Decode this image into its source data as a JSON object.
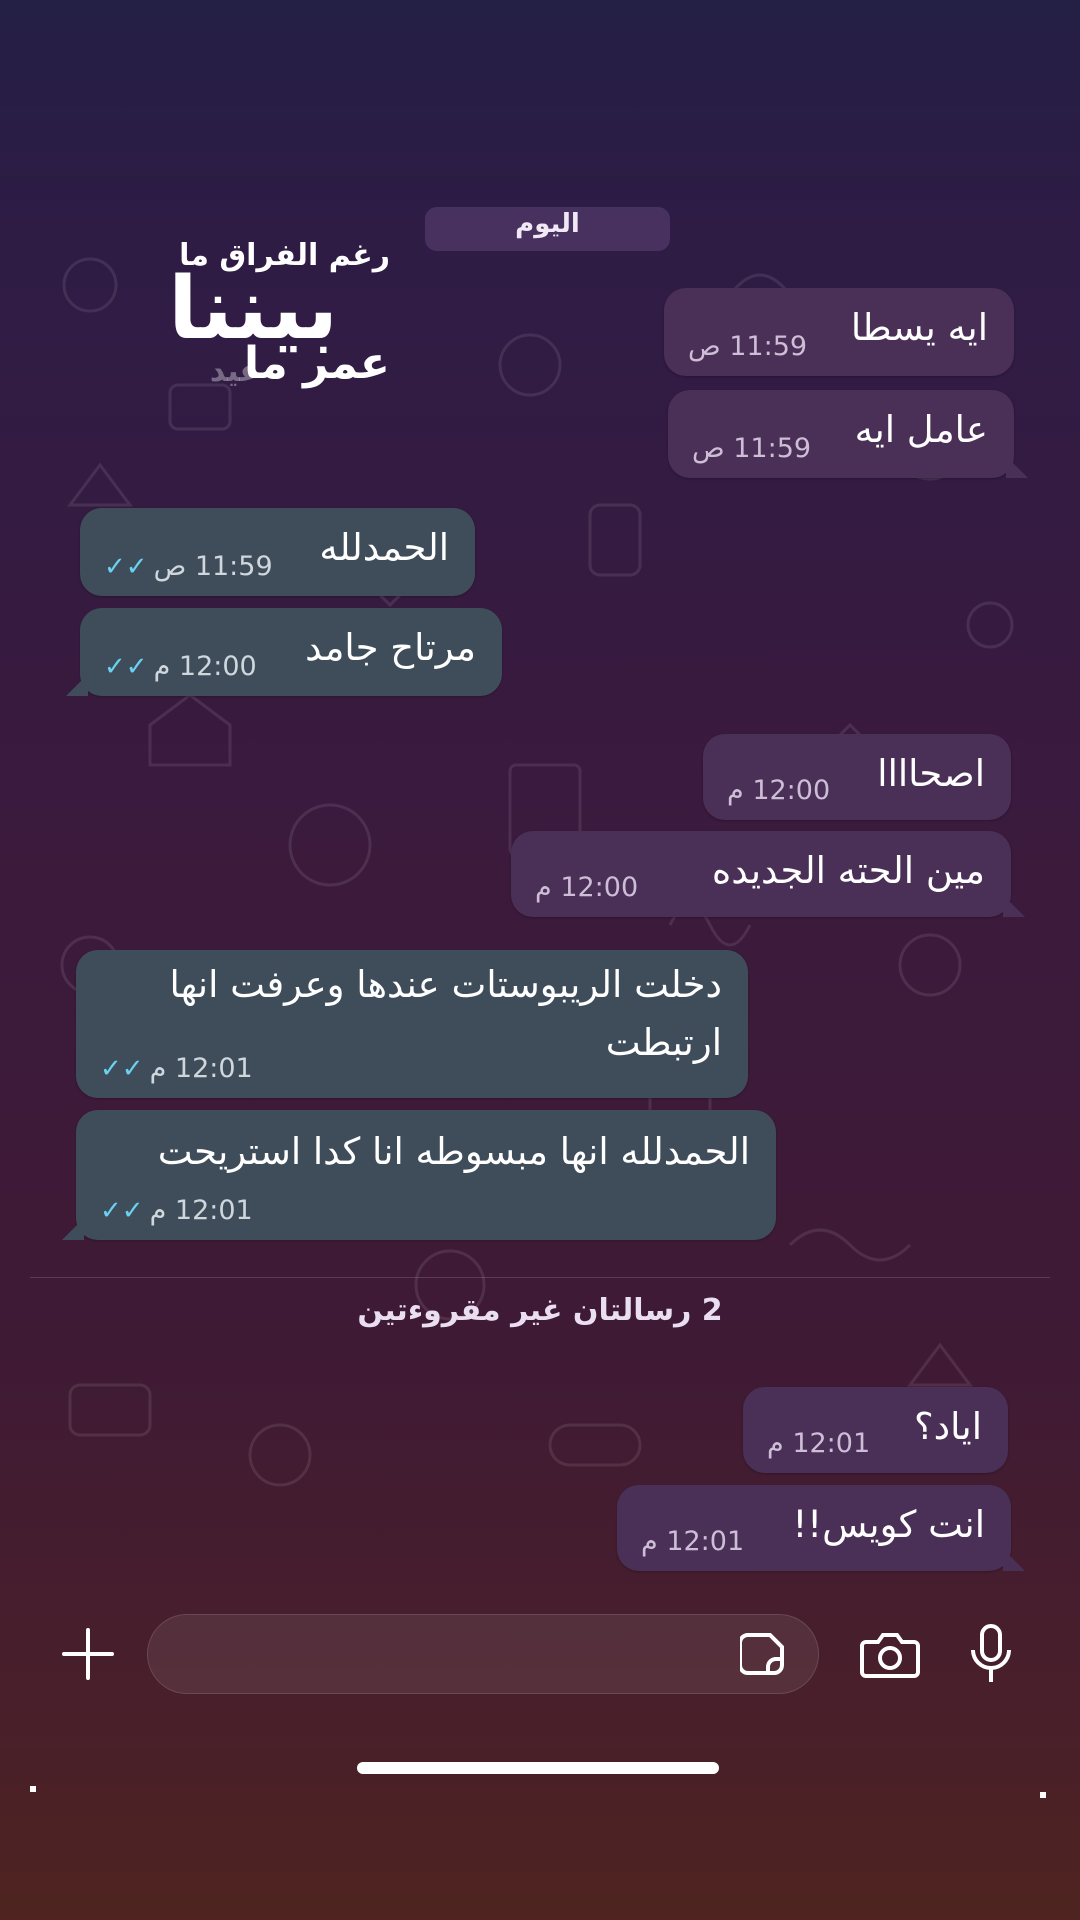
{
  "date_chip": "اليوم",
  "overlay": {
    "line1": "رغم الفراق ما",
    "line2": "بيننا",
    "line3": "عمر ما",
    "line4": "عيد"
  },
  "messages": [
    {
      "text": "ايه يسطا",
      "time": "11:59 ص",
      "direction": "incoming"
    },
    {
      "text": "عامل ايه",
      "time": "11:59 ص",
      "direction": "incoming"
    },
    {
      "text": "الحمدلله",
      "time": "11:59 ص",
      "direction": "outgoing",
      "status": "read"
    },
    {
      "text": "مرتاح جامد",
      "time": "12:00 م",
      "direction": "outgoing",
      "status": "read"
    },
    {
      "text": "اصحاااا",
      "time": "12:00 م",
      "direction": "incoming"
    },
    {
      "text": "مين الحته الجديده",
      "time": "12:00 م",
      "direction": "incoming"
    },
    {
      "text": "دخلت الريبوستات عندها وعرفت انها ارتبطت",
      "time": "12:01 م",
      "direction": "outgoing",
      "status": "read"
    },
    {
      "text": "الحمدلله انها مبسوطه انا كدا استريحت",
      "time": "12:01 م",
      "direction": "outgoing",
      "status": "read"
    },
    {
      "text": "اياد؟",
      "time": "12:01 م",
      "direction": "incoming"
    },
    {
      "text": "انت كويس!!",
      "time": "12:01 م",
      "direction": "incoming"
    }
  ],
  "unread_divider": "2 رسالتان غير مقروءتين",
  "input": {
    "placeholder": ""
  },
  "icons": {
    "read_ticks": "✓✓",
    "plus": "plus-icon",
    "sticker": "sticker-icon",
    "camera": "camera-icon",
    "mic": "microphone-icon"
  },
  "colors": {
    "incoming_bubble": "#4a2f57",
    "outgoing_bubble": "#3f4d5a",
    "read_tick": "#6ad1f0"
  }
}
